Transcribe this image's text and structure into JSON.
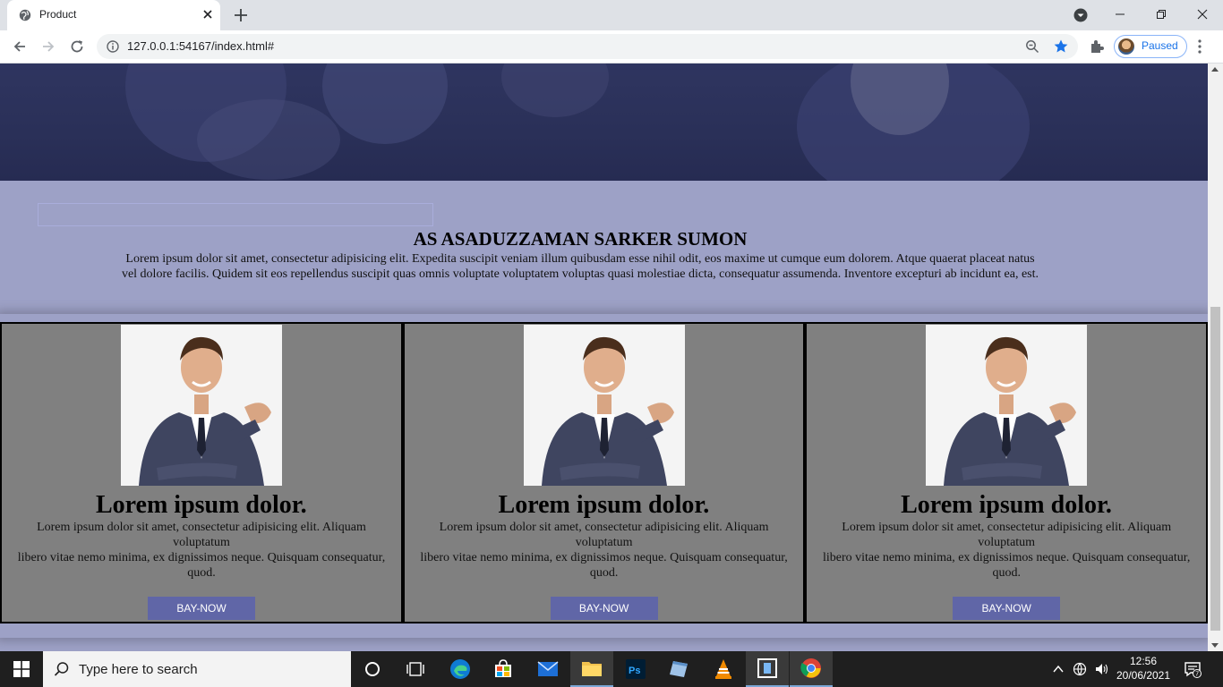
{
  "browser": {
    "tab_title": "Product",
    "url": "127.0.0.1:54167/index.html#",
    "profile_label": "Paused"
  },
  "page": {
    "intro_title": "AS ASADUZZAMAN SARKER SUMON",
    "intro_line1": "Lorem ipsum dolor sit amet, consectetur adipisicing elit. Expedita suscipit veniam illum quibusdam esse nihil odit, eos maxime ut cumque eum dolorem. Atque quaerat placeat natus",
    "intro_line2": "vel dolore facilis. Quidem sit eos repellendus suscipit quas omnis voluptate voluptatem voluptas quasi molestiae dicta, consequatur assumenda. Inventore excepturi ab incidunt ea, est.",
    "cards": [
      {
        "title": "Lorem ipsum dolor.",
        "text_line1": "Lorem ipsum dolor sit amet, consectetur adipisicing elit. Aliquam voluptatum",
        "text_line2": "libero vitae nemo minima, ex dignissimos neque. Quisquam consequatur, quod.",
        "button": "BAY-NOW"
      },
      {
        "title": "Lorem ipsum dolor.",
        "text_line1": "Lorem ipsum dolor sit amet, consectetur adipisicing elit. Aliquam voluptatum",
        "text_line2": "libero vitae nemo minima, ex dignissimos neque. Quisquam consequatur, quod.",
        "button": "BAY-NOW"
      },
      {
        "title": "Lorem ipsum dolor.",
        "text_line1": "Lorem ipsum dolor sit amet, consectetur adipisicing elit. Aliquam voluptatum",
        "text_line2": "libero vitae nemo minima, ex dignissimos neque. Quisquam consequatur, quod.",
        "button": "BAY-NOW"
      }
    ]
  },
  "taskbar": {
    "search_placeholder": "Type here to search",
    "time": "12:56",
    "date": "20/06/2021",
    "notification_count": "7",
    "apps": [
      "cortana-icon",
      "task-view-icon",
      "edge-icon",
      "store-icon",
      "mail-icon",
      "file-explorer-icon",
      "photoshop-icon",
      "notepad-icon",
      "vlc-icon",
      "app-icon",
      "chrome-icon"
    ]
  },
  "colors": {
    "page_bg": "#9da1c6",
    "card_bg": "#808080",
    "button_bg": "#6066a7",
    "hero_bg": "#2a3058"
  }
}
